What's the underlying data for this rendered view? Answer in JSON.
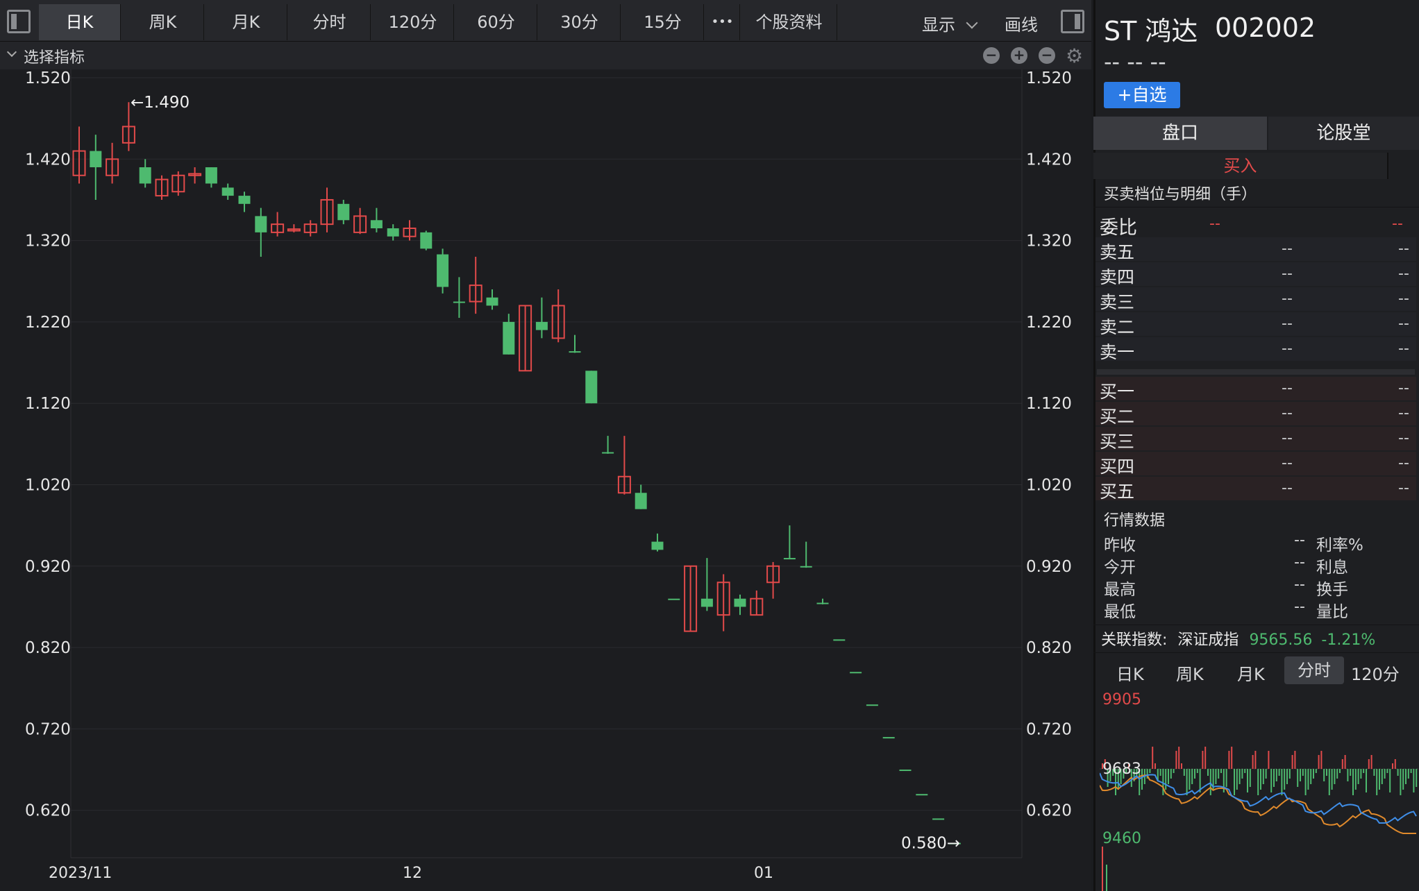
{
  "toolbar": {
    "tabs": [
      "日K",
      "周K",
      "月K",
      "分时",
      "120分",
      "60分",
      "30分",
      "15分"
    ],
    "more": "•••",
    "info": "个股资料",
    "display": "显示",
    "draw": "画线"
  },
  "subbar": {
    "label": "选择指标"
  },
  "chart": {
    "y_ticks": [
      "1.520",
      "1.420",
      "1.320",
      "1.220",
      "1.120",
      "1.020",
      "0.920",
      "0.820",
      "0.720",
      "0.620"
    ],
    "x_labels": [
      "2023/11",
      "12",
      "01"
    ],
    "high_label": "←1.490",
    "low_label": "0.580→",
    "colors": {
      "up": "#e24a4a",
      "down": "#4eba6f",
      "grid": "#2a2b2f",
      "bg": "#1c1d20"
    },
    "candles": [
      {
        "o": 1.4,
        "c": 1.43,
        "h": 1.46,
        "l": 1.39
      },
      {
        "o": 1.43,
        "c": 1.41,
        "h": 1.45,
        "l": 1.37
      },
      {
        "o": 1.4,
        "c": 1.42,
        "h": 1.44,
        "l": 1.39
      },
      {
        "o": 1.44,
        "c": 1.46,
        "h": 1.49,
        "l": 1.43
      },
      {
        "o": 1.41,
        "c": 1.39,
        "h": 1.42,
        "l": 1.385
      },
      {
        "o": 1.375,
        "c": 1.395,
        "h": 1.4,
        "l": 1.37
      },
      {
        "o": 1.38,
        "c": 1.4,
        "h": 1.405,
        "l": 1.375
      },
      {
        "o": 1.4,
        "c": 1.402,
        "h": 1.41,
        "l": 1.39
      },
      {
        "o": 1.41,
        "c": 1.39,
        "h": 1.41,
        "l": 1.385
      },
      {
        "o": 1.385,
        "c": 1.375,
        "h": 1.39,
        "l": 1.37
      },
      {
        "o": 1.375,
        "c": 1.365,
        "h": 1.38,
        "l": 1.355
      },
      {
        "o": 1.35,
        "c": 1.33,
        "h": 1.36,
        "l": 1.3
      },
      {
        "o": 1.33,
        "c": 1.34,
        "h": 1.355,
        "l": 1.325
      },
      {
        "o": 1.332,
        "c": 1.334,
        "h": 1.34,
        "l": 1.33
      },
      {
        "o": 1.33,
        "c": 1.34,
        "h": 1.345,
        "l": 1.325
      },
      {
        "o": 1.34,
        "c": 1.37,
        "h": 1.385,
        "l": 1.33
      },
      {
        "o": 1.365,
        "c": 1.345,
        "h": 1.37,
        "l": 1.34
      },
      {
        "o": 1.33,
        "c": 1.35,
        "h": 1.36,
        "l": 1.328
      },
      {
        "o": 1.345,
        "c": 1.335,
        "h": 1.36,
        "l": 1.33
      },
      {
        "o": 1.335,
        "c": 1.325,
        "h": 1.34,
        "l": 1.32
      },
      {
        "o": 1.325,
        "c": 1.335,
        "h": 1.345,
        "l": 1.32
      },
      {
        "o": 1.33,
        "c": 1.31,
        "h": 1.332,
        "l": 1.308
      },
      {
        "o": 1.303,
        "c": 1.263,
        "h": 1.31,
        "l": 1.255
      },
      {
        "o": 1.245,
        "c": 1.244,
        "h": 1.275,
        "l": 1.225
      },
      {
        "o": 1.245,
        "c": 1.265,
        "h": 1.3,
        "l": 1.23
      },
      {
        "o": 1.25,
        "c": 1.24,
        "h": 1.26,
        "l": 1.235
      },
      {
        "o": 1.22,
        "c": 1.18,
        "h": 1.23,
        "l": 1.18
      },
      {
        "o": 1.16,
        "c": 1.24,
        "h": 1.24,
        "l": 1.16
      },
      {
        "o": 1.22,
        "c": 1.21,
        "h": 1.25,
        "l": 1.2
      },
      {
        "o": 1.2,
        "c": 1.24,
        "h": 1.26,
        "l": 1.195
      },
      {
        "o": 1.184,
        "c": 1.184,
        "h": 1.204,
        "l": 1.182
      },
      {
        "o": 1.16,
        "c": 1.12,
        "h": 1.16,
        "l": 1.12
      },
      {
        "o": 1.06,
        "c": 1.06,
        "h": 1.08,
        "l": 1.058
      },
      {
        "o": 1.01,
        "c": 1.03,
        "h": 1.08,
        "l": 1.008
      },
      {
        "o": 1.01,
        "c": 0.99,
        "h": 1.02,
        "l": 0.99
      },
      {
        "o": 0.95,
        "c": 0.94,
        "h": 0.96,
        "l": 0.938
      },
      {
        "o": 0.88,
        "c": 0.88,
        "h": 0.88,
        "l": 0.88
      },
      {
        "o": 0.84,
        "c": 0.92,
        "h": 0.92,
        "l": 0.84
      },
      {
        "o": 0.88,
        "c": 0.87,
        "h": 0.93,
        "l": 0.865
      },
      {
        "o": 0.86,
        "c": 0.9,
        "h": 0.91,
        "l": 0.84
      },
      {
        "o": 0.88,
        "c": 0.87,
        "h": 0.885,
        "l": 0.86
      },
      {
        "o": 0.86,
        "c": 0.88,
        "h": 0.89,
        "l": 0.86
      },
      {
        "o": 0.9,
        "c": 0.92,
        "h": 0.925,
        "l": 0.88
      },
      {
        "o": 0.93,
        "c": 0.93,
        "h": 0.97,
        "l": 0.93
      },
      {
        "o": 0.92,
        "c": 0.92,
        "h": 0.95,
        "l": 0.918
      },
      {
        "o": 0.875,
        "c": 0.875,
        "h": 0.88,
        "l": 0.873
      },
      {
        "o": 0.83,
        "c": 0.83,
        "h": 0.83,
        "l": 0.83
      },
      {
        "o": 0.79,
        "c": 0.79,
        "h": 0.79,
        "l": 0.79
      },
      {
        "o": 0.75,
        "c": 0.75,
        "h": 0.75,
        "l": 0.75
      },
      {
        "o": 0.71,
        "c": 0.71,
        "h": 0.71,
        "l": 0.71
      },
      {
        "o": 0.67,
        "c": 0.67,
        "h": 0.67,
        "l": 0.67
      },
      {
        "o": 0.64,
        "c": 0.64,
        "h": 0.64,
        "l": 0.64
      },
      {
        "o": 0.61,
        "c": 0.61,
        "h": 0.61,
        "l": 0.61
      },
      {
        "o": 0.58,
        "c": 0.58,
        "h": 0.58,
        "l": 0.58
      }
    ]
  },
  "stock": {
    "name": "ST 鸿达",
    "code": "002002",
    "price": "-- -- --",
    "add_btn": "+自选"
  },
  "panel_tabs": [
    "盘口",
    "论股堂"
  ],
  "buy_label": "买入",
  "orderbook": {
    "title": "买卖档位与明细（手）",
    "ratio_label": "委比",
    "ratio_a": "--",
    "ratio_b": "--",
    "asks": [
      "卖五",
      "卖四",
      "卖三",
      "卖二",
      "卖一"
    ],
    "bids": [
      "买一",
      "买二",
      "买三",
      "买四",
      "买五"
    ],
    "empty": "--"
  },
  "market": {
    "title": "行情数据",
    "rows": [
      {
        "l": "昨收",
        "v": "--",
        "r": "利率%"
      },
      {
        "l": "今开",
        "v": "--",
        "r": "利息"
      },
      {
        "l": "最高",
        "v": "--",
        "r": "换手"
      },
      {
        "l": "最低",
        "v": "--",
        "r": "量比"
      }
    ]
  },
  "index": {
    "label": "关联指数:",
    "name": "深证成指",
    "value": "9565.56",
    "change": "-1.21%"
  },
  "mini_tabs": [
    "日K",
    "周K",
    "月K",
    "分时",
    "120分"
  ],
  "mini": {
    "top": "9905",
    "mid": "9683",
    "bot": "9460"
  }
}
